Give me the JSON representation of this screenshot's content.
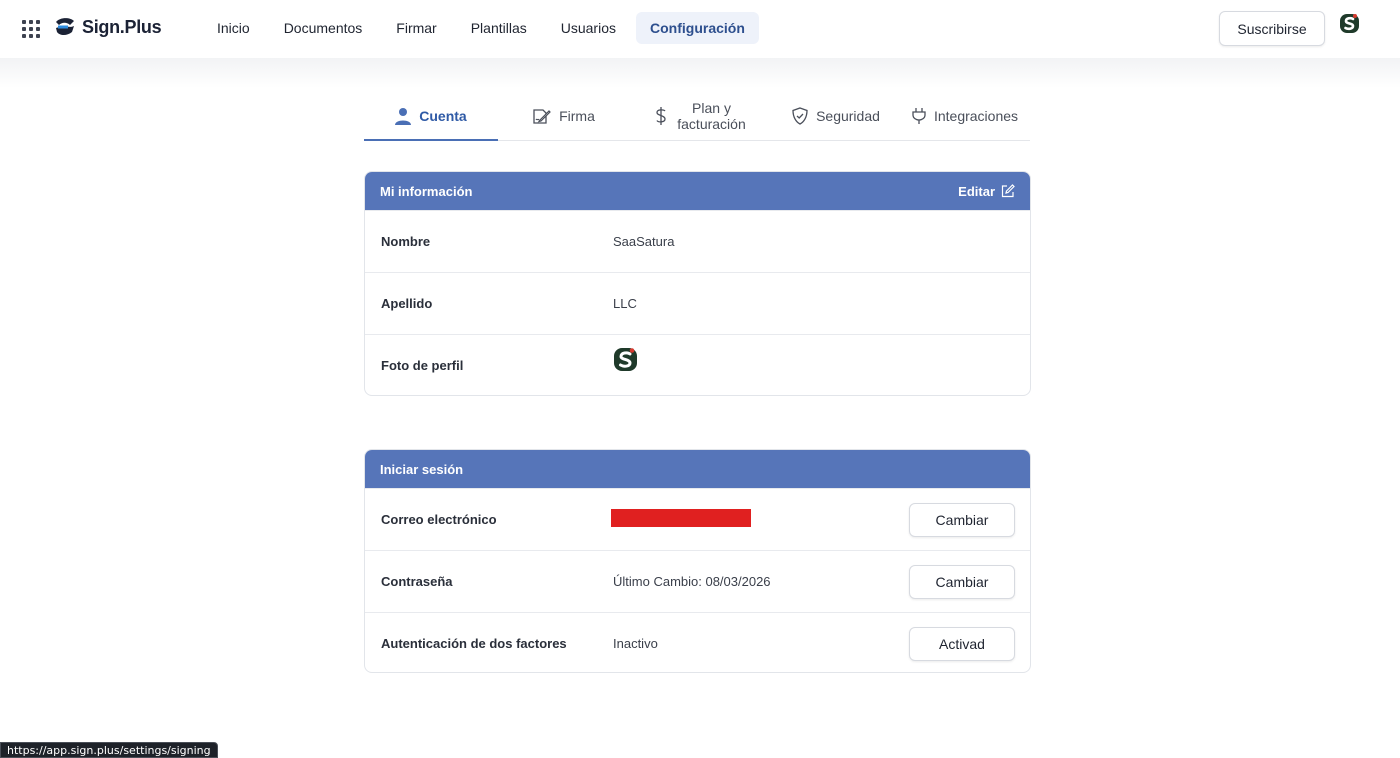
{
  "brand": {
    "name": "Sign.Plus"
  },
  "nav": {
    "items": [
      {
        "label": "Inicio",
        "active": false
      },
      {
        "label": "Documentos",
        "active": false
      },
      {
        "label": "Firmar",
        "active": false
      },
      {
        "label": "Plantillas",
        "active": false
      },
      {
        "label": "Usuarios",
        "active": false
      },
      {
        "label": "Configuración",
        "active": true
      }
    ],
    "subscribe_label": "Suscribirse",
    "accent": "#2d4f8e"
  },
  "tabs": [
    {
      "label": "Cuenta",
      "icon": "user-icon",
      "active": true
    },
    {
      "label": "Firma",
      "icon": "signature-icon",
      "active": false
    },
    {
      "label": "Plan y facturación",
      "icon": "dollar-icon",
      "active": false
    },
    {
      "label": "Seguridad",
      "icon": "shield-icon",
      "active": false
    },
    {
      "label": "Integraciones",
      "icon": "plug-icon",
      "active": false
    }
  ],
  "my_info": {
    "title": "Mi información",
    "edit_label": "Editar",
    "rows": [
      {
        "label": "Nombre",
        "value": "SaaSatura"
      },
      {
        "label": "Apellido",
        "value": "LLC"
      },
      {
        "label": "Foto de perfil",
        "value": ""
      }
    ]
  },
  "login": {
    "title": "Iniciar sesión",
    "rows": [
      {
        "label": "Correo electrónico",
        "value": "",
        "button": "Cambiar",
        "redacted": true
      },
      {
        "label": "Contraseña",
        "value": "Último Cambio: 08/03/2026",
        "button": "Cambiar"
      },
      {
        "label": "Autenticación de dos factores",
        "value": "Inactivo",
        "button": "Activad"
      }
    ]
  },
  "status_url": "https://app.sign.plus/settings/signing",
  "colors": {
    "header_blue": "#5675b9",
    "tab_active": "#2f5aa6",
    "redaction": "#e02020"
  }
}
